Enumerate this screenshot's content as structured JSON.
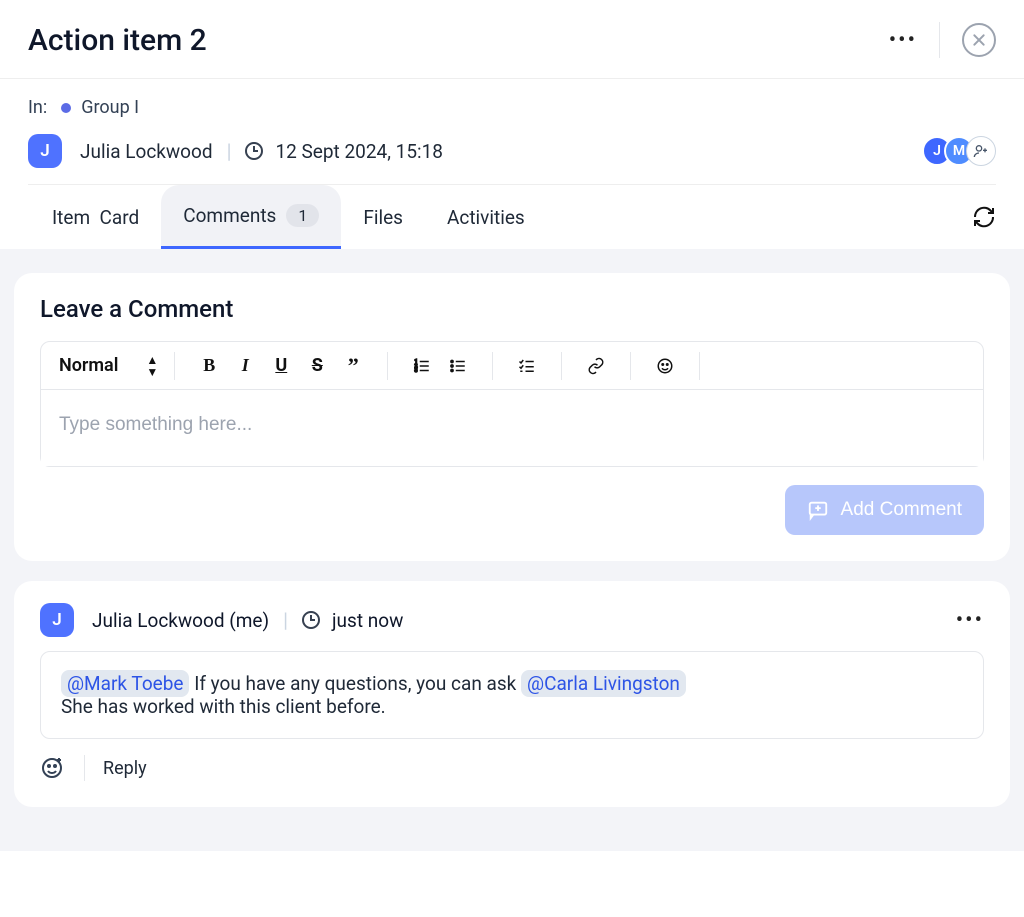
{
  "header": {
    "title": "Action item 2"
  },
  "meta": {
    "in_label": "In:",
    "group": "Group I",
    "author": "Julia Lockwood",
    "author_initial": "J",
    "timestamp": "12 Sept 2024, 15:18",
    "participants": [
      {
        "initial": "J"
      },
      {
        "initial": "M"
      }
    ]
  },
  "tabs": {
    "item_card": "Item  Card",
    "comments": "Comments",
    "comments_count": "1",
    "files": "Files",
    "activities": "Activities"
  },
  "composer": {
    "heading": "Leave a Comment",
    "format_select": "Normal",
    "placeholder": "Type something here...",
    "add_button": "Add Comment"
  },
  "comment": {
    "author_initial": "J",
    "author": "Julia Lockwood (me)",
    "time": "just now",
    "mention1": "@Mark Toebe",
    "body1": " If you have any questions, you can ask ",
    "mention2": "@Carla Livingston",
    "body2": "She has worked with this client before.",
    "reply": "Reply"
  }
}
